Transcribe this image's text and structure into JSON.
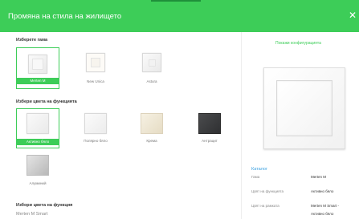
{
  "header": {
    "title": "Промяна на стила на жилището",
    "close_glyph": "✕",
    "color": "#3dcd58"
  },
  "sections": {
    "range_title": "Изберете гама",
    "function_color_title": "Избери цвета на функцията",
    "function_color_title_2": "Избори цвета на функция",
    "function_color_value": "Merten M Smart"
  },
  "ranges": [
    {
      "label": "Merten M",
      "selected": true
    },
    {
      "label": "New Unica",
      "selected": false
    },
    {
      "label": "Astura",
      "selected": false
    }
  ],
  "colors": [
    {
      "label": "Активно бяло",
      "selected": true,
      "swatch": "#f5f5f5"
    },
    {
      "label": "Полярно бяло",
      "selected": false,
      "swatch": "#f0f0f0"
    },
    {
      "label": "Крема",
      "selected": false,
      "swatch": "#efe9d9"
    },
    {
      "label": "Антрацит",
      "selected": false,
      "swatch": "#3e3f41"
    },
    {
      "label": "Алуминий",
      "selected": false,
      "swatch": "#c9c9c9"
    }
  ],
  "right": {
    "show_config": "Покажи конфигурацията",
    "catalog_title": "Каталог",
    "specs": [
      {
        "key": "Гама",
        "value": "Merten M"
      },
      {
        "key": "Цвят на функцията",
        "value": "Активно бяло"
      },
      {
        "key": "Цвят на рамката",
        "value": "Merten M Smart -"
      },
      {
        "key": "",
        "value": "Активно бяло"
      }
    ]
  },
  "accent_color": "#3dcd58",
  "link_color": "#3aa0e0"
}
